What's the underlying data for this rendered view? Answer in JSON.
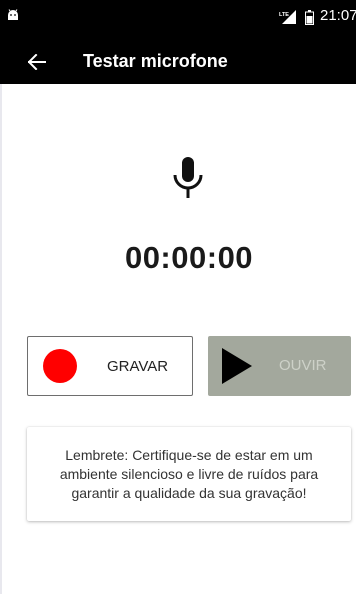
{
  "status_bar": {
    "time": "21:07",
    "icons": [
      "android-icon",
      "lte-signal-icon",
      "battery-icon"
    ]
  },
  "toolbar": {
    "title": "Testar microfone",
    "back_icon": "arrow-left-icon"
  },
  "recorder": {
    "icon": "microphone-icon",
    "timer": "00:00:00",
    "record_label": "GRAVAR",
    "listen_label": "OUVIR"
  },
  "reminder": {
    "text": "Lembrete: Certifique-se de estar em um ambiente silencioso e livre de ruídos para garantir a qualidade da sua gravação!"
  },
  "colors": {
    "bar_background": "#000000",
    "record_dot": "#ff0000",
    "listen_disabled": "#a3a89d"
  }
}
